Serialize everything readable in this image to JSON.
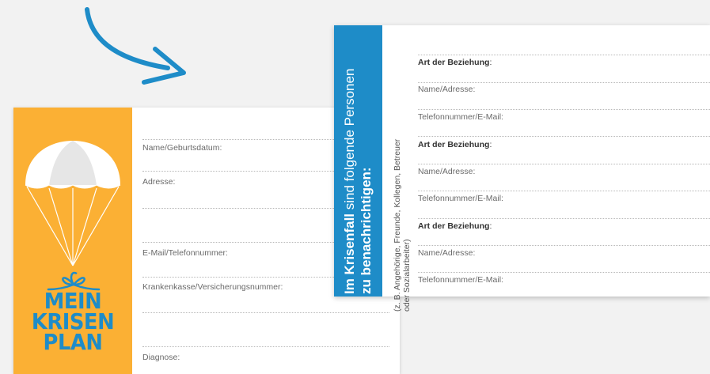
{
  "back_card": {
    "logo": {
      "line1": "MEIN",
      "line2": "KRISEN",
      "line3": "PLAN"
    },
    "fields": [
      {
        "label": "Name/Geburtsdatum:"
      },
      {
        "label": "Adresse:"
      },
      {
        "label": "E-Mail/Telefonnummer:"
      },
      {
        "label": "Krankenkasse/Versicherungsnummer:"
      },
      {
        "label": "Diagnose:"
      }
    ]
  },
  "front_card": {
    "title_bold": "Im Krisenfall",
    "title_rest": " sind folgende Personen",
    "title_line2": "zu benachrichtigen:",
    "subtitle_line1": "(z. B. Angehörige, Freunde, Kollegen, Betreuer",
    "subtitle_line2": "oder Sozialarbeiter)",
    "rows": [
      {
        "label": "Art der Beziehung",
        "colon": ":"
      },
      {
        "label": "Name/Adresse:"
      },
      {
        "label": "Telefonnummer/E-Mail:"
      },
      {
        "label": "Art der Beziehung",
        "colon": ":"
      },
      {
        "label": "Name/Adresse:"
      },
      {
        "label": "Telefonnummer/E-Mail:"
      },
      {
        "label": "Art der Beziehung",
        "colon": ":"
      },
      {
        "label": "Name/Adresse:"
      },
      {
        "label": "Telefonnummer/E-Mail:"
      }
    ]
  },
  "colors": {
    "orange": "#fbb034",
    "blue": "#1e8cc8",
    "background": "#f2f2f2"
  },
  "icons": {
    "arrow": "curved-arrow-icon",
    "parachute": "parachute-icon",
    "bow": "gift-bow-icon"
  }
}
